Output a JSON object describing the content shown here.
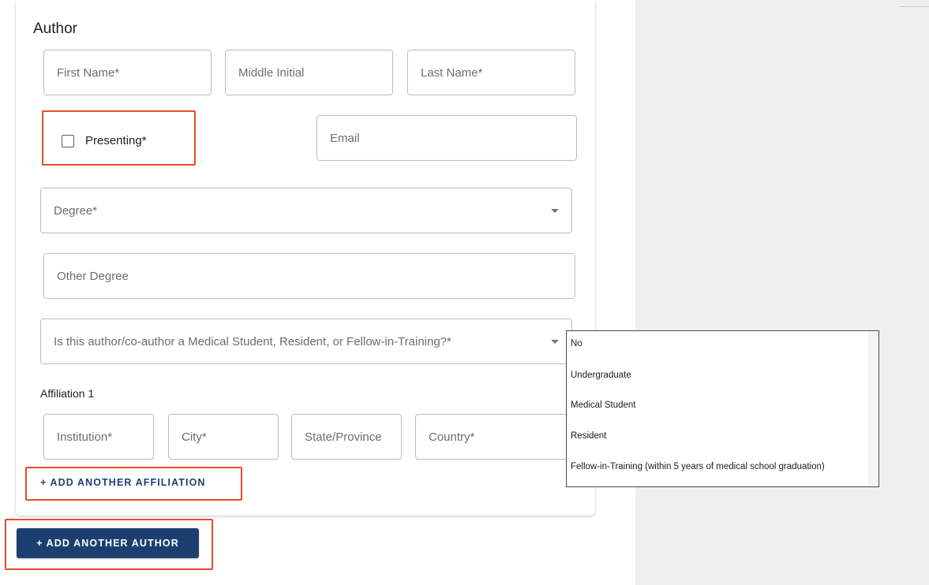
{
  "form": {
    "section_title": "Author",
    "first_name_placeholder": "First Name*",
    "middle_initial_placeholder": "Middle Initial",
    "last_name_placeholder": "Last Name*",
    "presenting_label": "Presenting*",
    "presenting_checked": false,
    "email_placeholder": "Email",
    "degree_placeholder": "Degree*",
    "other_degree_placeholder": "Other Degree",
    "trainee_question": "Is this author/co-author a Medical Student, Resident, or Fellow-in-Training?*",
    "affiliation_label": "Affiliation 1",
    "institution_placeholder": "Institution*",
    "city_placeholder": "City*",
    "state_placeholder": "State/Province",
    "country_placeholder": "Country*",
    "add_affiliation_label": "+ ADD ANOTHER AFFILIATION"
  },
  "add_author_label": "+ ADD ANOTHER AUTHOR",
  "trainee_options": [
    "No",
    "Undergraduate",
    "Medical Student",
    "Resident",
    "Fellow-in-Training (within 5 years of medical school graduation)"
  ],
  "colors": {
    "primary": "#1d3f70",
    "highlight": "#ea4b2a",
    "panel": "#efefef"
  }
}
